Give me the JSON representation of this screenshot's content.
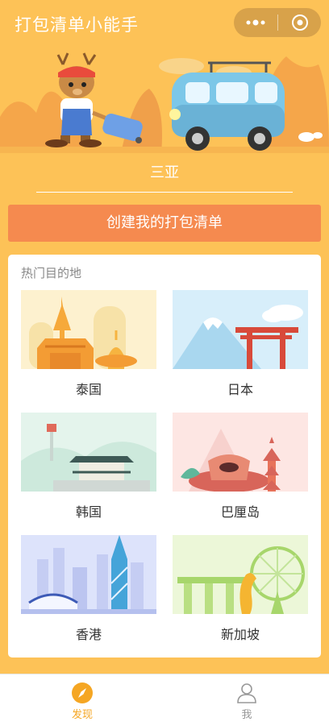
{
  "header": {
    "title": "打包清单小能手"
  },
  "hero": {
    "accent": "#fdc257"
  },
  "destination": {
    "value": "三亚"
  },
  "create_button": {
    "label": "创建我的打包清单"
  },
  "hot_section": {
    "title": "热门目的地",
    "items": [
      {
        "label": "泰国"
      },
      {
        "label": "日本"
      },
      {
        "label": "韩国"
      },
      {
        "label": "巴厘岛"
      },
      {
        "label": "香港"
      },
      {
        "label": "新加坡"
      }
    ]
  },
  "tabbar": {
    "items": [
      {
        "label": "发现",
        "icon": "compass-icon",
        "active": true,
        "color": "#f5a623"
      },
      {
        "label": "我",
        "icon": "person-icon",
        "active": false,
        "color": "#999999"
      }
    ]
  }
}
